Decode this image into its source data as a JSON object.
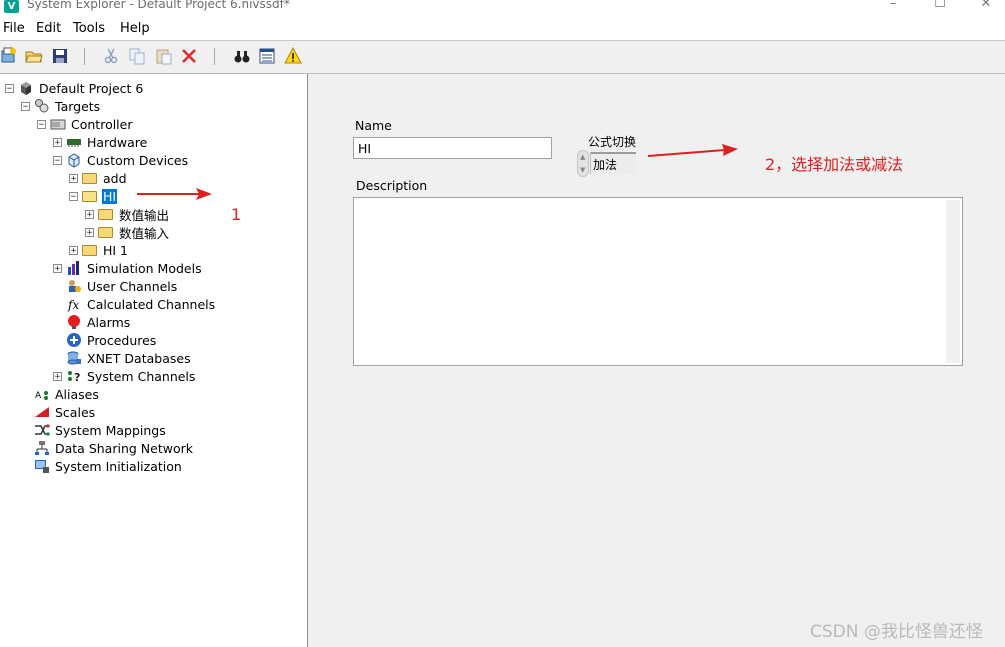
{
  "window": {
    "title": "System Explorer - Default Project 6.nivssdf*",
    "app_icon_letter": "V",
    "controls": [
      "–",
      "☐",
      "✕"
    ]
  },
  "menu": [
    "File",
    "Edit",
    "Tools",
    "Help"
  ],
  "toolbar": {
    "icons": [
      "new-icon",
      "open-icon",
      "save-icon",
      "cut-icon",
      "copy-icon",
      "paste-icon",
      "delete-icon",
      "find-icon",
      "properties-icon",
      "warning-icon"
    ]
  },
  "tree": [
    {
      "label": "Default Project 6",
      "icon": "project-icon",
      "expander": "−"
    },
    {
      "label": "Targets",
      "icon": "targets-icon",
      "expander": "−"
    },
    {
      "label": "Controller",
      "icon": "controller-icon",
      "expander": "−"
    },
    {
      "label": "Hardware",
      "icon": "hardware-icon",
      "expander": "+"
    },
    {
      "label": "Custom Devices",
      "icon": "custom-devices-icon",
      "expander": "−"
    },
    {
      "label": "add",
      "icon": "folder-icon",
      "expander": "+"
    },
    {
      "label": "HI",
      "icon": "folder-icon",
      "expander": "−",
      "selected": true
    },
    {
      "label": "数值输出",
      "icon": "folder-icon",
      "expander": "+"
    },
    {
      "label": "数值输入",
      "icon": "folder-icon",
      "expander": "+"
    },
    {
      "label": "HI 1",
      "icon": "folder-icon",
      "expander": "+"
    },
    {
      "label": "Simulation Models",
      "icon": "simulation-models-icon",
      "expander": "+"
    },
    {
      "label": "User Channels",
      "icon": "user-channels-icon",
      "expander": ""
    },
    {
      "label": "Calculated Channels",
      "icon": "calculated-channels-icon",
      "expander": ""
    },
    {
      "label": "Alarms",
      "icon": "alarms-icon",
      "expander": ""
    },
    {
      "label": "Procedures",
      "icon": "procedures-icon",
      "expander": ""
    },
    {
      "label": "XNET Databases",
      "icon": "xnet-databases-icon",
      "expander": ""
    },
    {
      "label": "System Channels",
      "icon": "system-channels-icon",
      "expander": "+"
    },
    {
      "label": "Aliases",
      "icon": "aliases-icon",
      "expander": ""
    },
    {
      "label": "Scales",
      "icon": "scales-icon",
      "expander": ""
    },
    {
      "label": "System Mappings",
      "icon": "system-mappings-icon",
      "expander": ""
    },
    {
      "label": "Data Sharing Network",
      "icon": "data-sharing-network-icon",
      "expander": ""
    },
    {
      "label": "System Initialization",
      "icon": "system-initialization-icon",
      "expander": ""
    }
  ],
  "form": {
    "name_label": "Name",
    "name_value": "HI",
    "ring_label": "公式切换",
    "ring_value": "加法",
    "description_label": "Description",
    "description_value": ""
  },
  "annotations": {
    "step1": "1",
    "step2": "2，选择加法或减法",
    "color": "#e02020"
  },
  "watermark": "CSDN @我比怪兽还怪"
}
